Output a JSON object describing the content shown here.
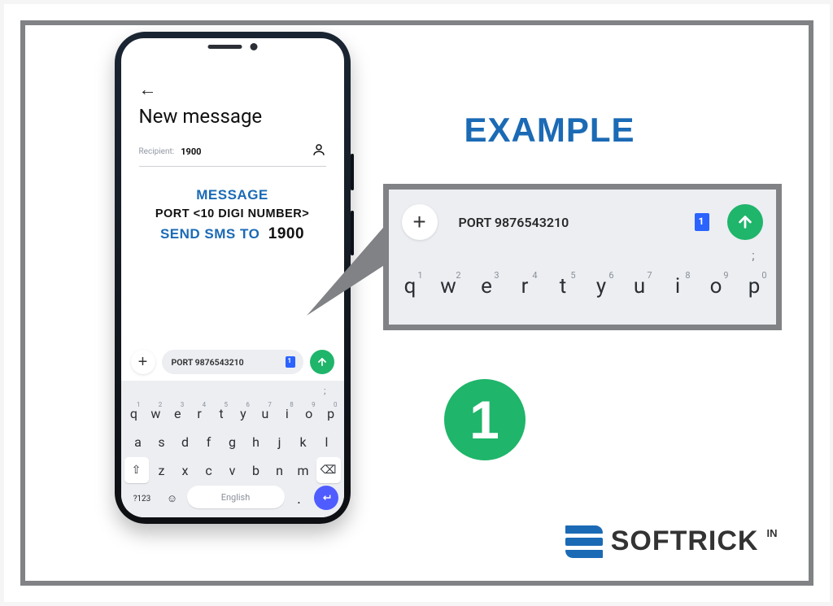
{
  "app": {
    "title": "New message",
    "recipient_label": "Recipient:",
    "recipient_value": "1900"
  },
  "instructions": {
    "line1": "MESSAGE",
    "line2": "PORT <10 DIGI NUMBER>",
    "line3_a": "SEND SMS TO",
    "line3_b": "1900"
  },
  "compose": {
    "text": "PORT 9876543210"
  },
  "keyboard": {
    "hint": ";",
    "row1": [
      {
        "k": "q",
        "n": "1"
      },
      {
        "k": "w",
        "n": "2"
      },
      {
        "k": "e",
        "n": "3"
      },
      {
        "k": "r",
        "n": "4"
      },
      {
        "k": "t",
        "n": "5"
      },
      {
        "k": "y",
        "n": "6"
      },
      {
        "k": "u",
        "n": "7"
      },
      {
        "k": "i",
        "n": "8"
      },
      {
        "k": "o",
        "n": "9"
      },
      {
        "k": "p",
        "n": "0"
      }
    ],
    "row2": [
      "a",
      "s",
      "d",
      "f",
      "g",
      "h",
      "j",
      "k",
      "l"
    ],
    "row3": [
      "z",
      "x",
      "c",
      "v",
      "b",
      "n",
      "m"
    ],
    "space_label": "English",
    "numkey": "?123"
  },
  "example": {
    "title": "EXAMPLE",
    "compose_text": "PORT 9876543210"
  },
  "step": "1",
  "brand": {
    "name": "SOFTRICK",
    "tld": "IN"
  }
}
